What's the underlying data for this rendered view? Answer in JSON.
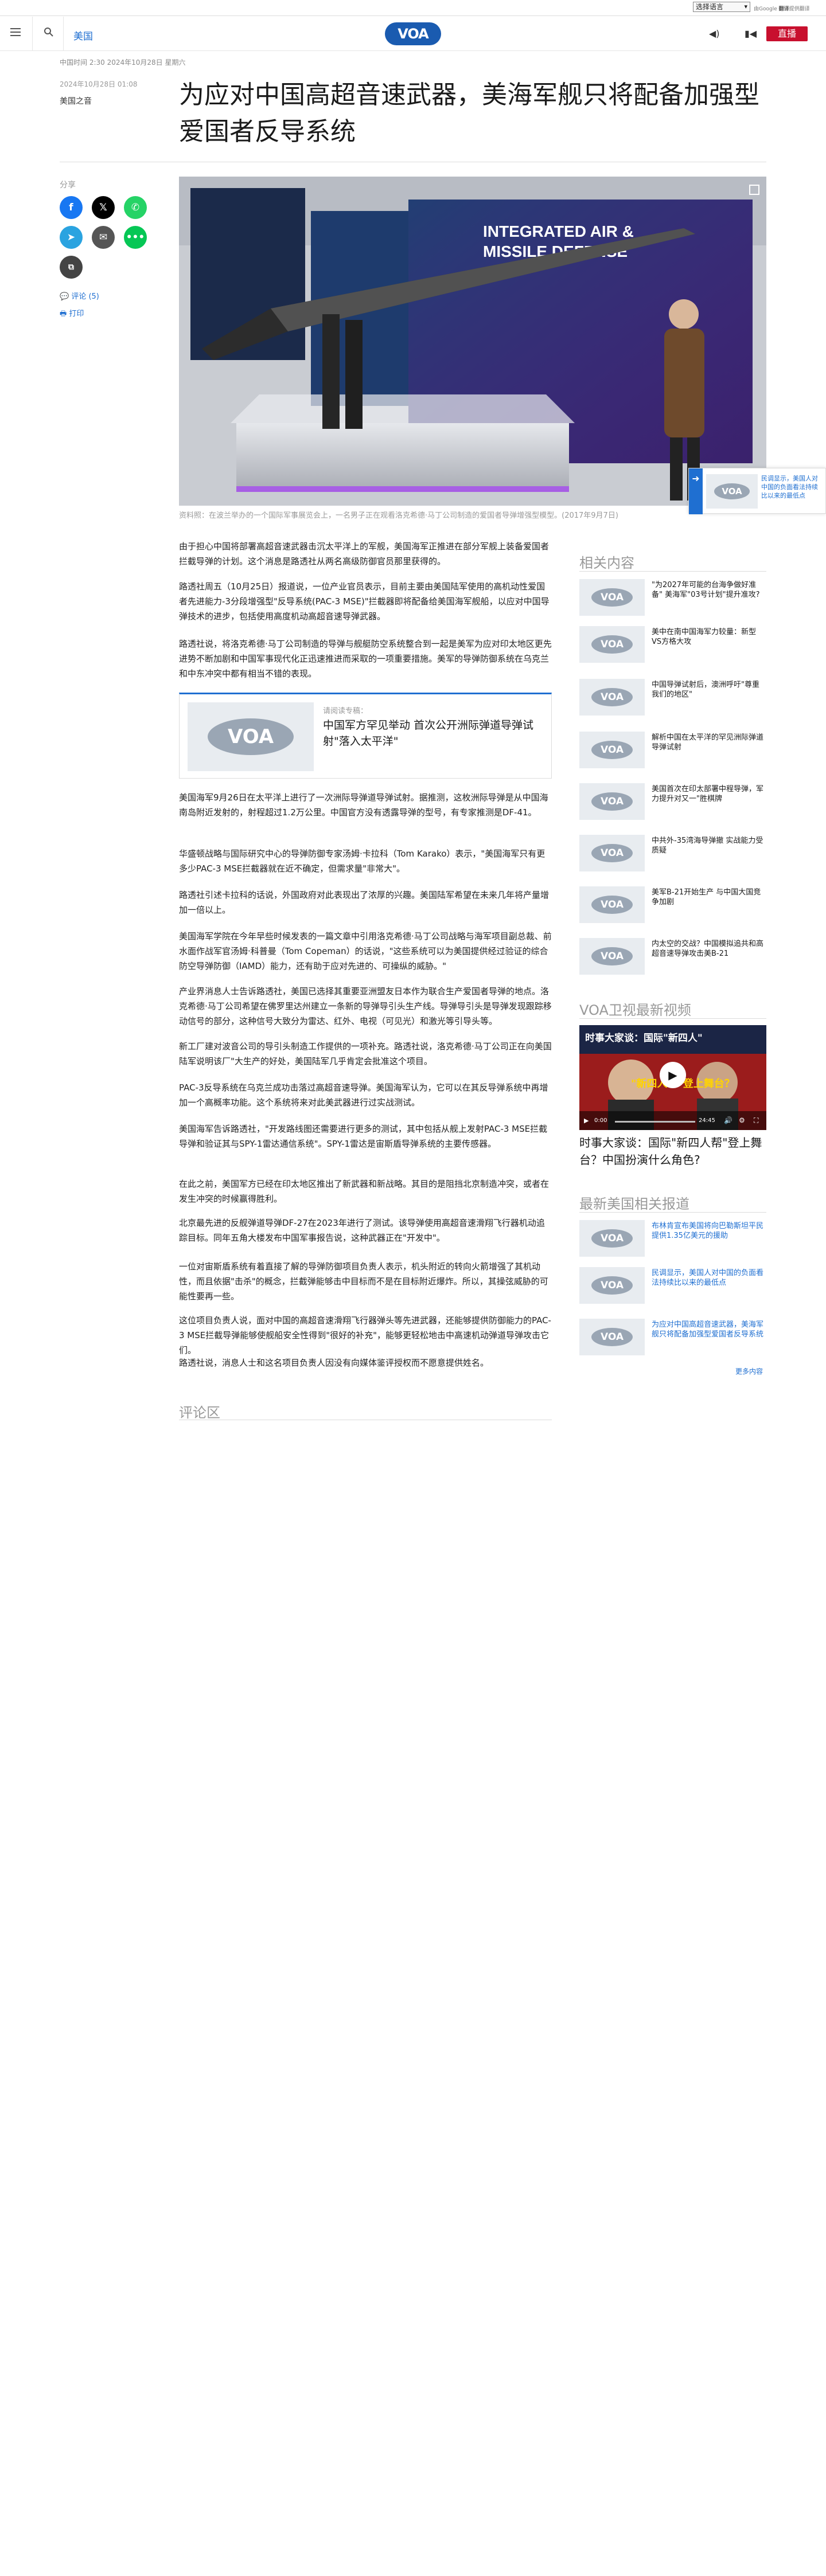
{
  "translate_bar": {
    "select_label": "选择语言",
    "powered_by": "由Google",
    "service": "翻译",
    "provider": "提供翻译"
  },
  "header": {
    "nav_link": "美国",
    "logo": "VOA",
    "live_button": "直播"
  },
  "article": {
    "topline": "中国时间 2:30 2024年10月28日 星期六",
    "date": "2024年10月28日 01:08",
    "author": "美国之音",
    "title": "为应对中国高超音速武器，美海军舰只将配备加强型爱国者反导系统",
    "image_caption": "资料照：在波兰举办的一个国际军事展览会上，一名男子正在观看洛克希德·马丁公司制造的爱国者导弹增强型模型。(2017年9月7日)",
    "paragraphs": [
      "由于担心中国将部署高超音速武器击沉太平洋上的军舰，美国海军正推进在部分军舰上装备爱国者拦截导弹的计划。这个消息是路透社从两名高级防御官员那里获得的。",
      "路透社周五（10月25日）报道说，一位产业官员表示，目前主要由美国陆军使用的高机动性爱国者先进能力-3分段增强型\"反导系统(PAC-3 MSE)\"拦截器即将配备给美国海军舰船，以应对中国导弹技术的进步，包括使用高度机动高超音速导弹武器。",
      "路透社说，将洛克希德·马丁公司制造的导弹与舰艇防空系统整合到一起是美军为应对印太地区更先进势不断加剧和中国军事现代化正迅速推进而采取的一项重要措施。美军的导弹防御系统在乌克兰和中东冲突中都有相当不错的表现。",
      "美国海军9月26日在太平洋上进行了一次洲际导弹道导弹试射。据推测，这枚洲际导弹是从中国海南岛附近发射的，射程超过1.2万公里。中国官方没有透露导弹的型号，有专家推测是DF-41。",
      "华盛顿战略与国际研究中心的导弹防御专家汤姆·卡拉科（Tom Karako）表示，\"美国海军只有更多少PAC-3 MSE拦截器就在近不确定，但需求量\"非常大\"。",
      "路透社引述卡拉科的话说，外国政府对此表现出了浓厚的兴趣。美国陆军希望在未来几年将产量增加一倍以上。",
      "美国海军学院在今年早些时候发表的一篇文章中引用洛克希德·马丁公司战略与海军项目副总裁、前水面作战军官汤姆·科普曼（Tom Copeman）的话说，\"这些系统可以为美国提供经过验证的综合防空导弹防御（IAMD）能力，还有助于应对先进的、可操纵的威胁。\"",
      "产业界消息人士告诉路透社，美国已选择其重要亚洲盟友日本作为联合生产爱国者导弹的地点。洛克希德·马丁公司希望在佛罗里达州建立一条新的导弹导引头生产线。导弹导引头是导弹发现跟踪移动信号的部分，这种信号大致分为雷达、红外、电视（可见光）和激光等引导头等。",
      "新工厂建对波音公司的导引头制造工作提供的一项补充。路透社说，洛克希德·马丁公司正在向美国陆军说明该厂\"大生产的好处，美国陆军几乎肯定会批准这个项目。",
      "PAC-3反导系统在乌克兰成功击落过高超音速导弹。美国海军认为，它可以在其反导弹系统中再增加一个高概率功能。这个系统将来对此美武器进行过实战测试。",
      "美国海军告诉路透社，\"开发路线图还需要进行更多的测试，其中包括从舰上发射PAC-3 MSE拦截导弹和验证其与SPY-1雷达通信系统\"。SPY-1雷达是宙斯盾导弹系统的主要传感器。",
      "在此之前，美国军方已经在印太地区推出了新武器和新战略。其目的是阻挡北京制造冲突，或者在发生冲突的时候赢得胜利。",
      "北京最先进的反舰弹道导弹DF-27在2023年进行了测试。该导弹使用高超音速滑翔飞行器机动追踪目标。同年五角大楼发布中国军事报告说，这种武器正在\"开发中\"。",
      "一位对宙斯盾系统有着直接了解的导弹防御项目负责人表示，机头附近的转向火箭增强了其机动性，而且依据\"击杀\"的概念，拦截弹能够击中目标而不是在目标附近爆炸。所以，其操弦威胁的可能性要再一些。",
      "这位项目负责人说，面对中国的高超音速滑翔飞行器弹头等先进武器，还能够提供防御能力的PAC-3 MSE拦截导弹能够使舰船安全性得到\"很好的补充\"，能够更轻松地击中高速机动弹道导弹攻击它们。",
      "路透社说，消息人士和这名项目负责人因没有向媒体鉴评授权而不愿意提供姓名。"
    ],
    "related_card": {
      "subtitle": "请阅读专稿：",
      "title": "中国军方罕见举动 首次公开洲际弹道导弹试射\"落入太平洋\""
    },
    "comments_label": "评论区"
  },
  "share": {
    "label": "分享",
    "comments_link": "评论 (5)",
    "print_link": "打印"
  },
  "sidebar": {
    "related_title": "相关内容",
    "related": [
      "\"为2027年可能的台海争做好准备\" 美海军\"03号计划\"提升准攻?",
      "美中在南中国海军力较量：新型VS方格大攻",
      "中国导弹试射后，澳洲呼吁\"尊重我们的地区\"",
      "解析中国在太平洋的罕见洲际弹道导弹试射",
      "美国首次在印太部署中程导弹，军力提升对又一\"胜棋牌",
      "中共外-35湾海导弹撤 实战能力受质疑",
      "美军B-21开始生产 与中国大国竞争加剧",
      "内太空的交战？中国模拟追共和高超音速导弹攻击美B-21"
    ],
    "video_title": "VOA卫视最新视频",
    "video": {
      "overlay_headline": "时事大家谈：国际\"新四人\"",
      "overlay_sub": "\"新四人帮\"登上舞台？",
      "time": "0:00",
      "duration": "24:45",
      "caption": "时事大家谈：国际\"新四人帮\"登上舞台？中国扮演什么角色?"
    },
    "latest_title": "最新美国相关报道",
    "latest": [
      "布林肯宣布美国将向巴勒斯坦平民提供1.35亿美元的援助",
      "民调显示，美国人对中国的负面看法持续比以来的最低点",
      "为应对中国高超音速武器，美海军舰只将配备加强型爱国者反导系统"
    ],
    "more_label": "更多内容"
  },
  "floating": {
    "text": "民调显示，美国人对中国的负面看法持续比以来的最低点"
  },
  "colors": {
    "brand": "#1a5bb0",
    "link": "#1f6fd1",
    "live": "#c8102e"
  }
}
